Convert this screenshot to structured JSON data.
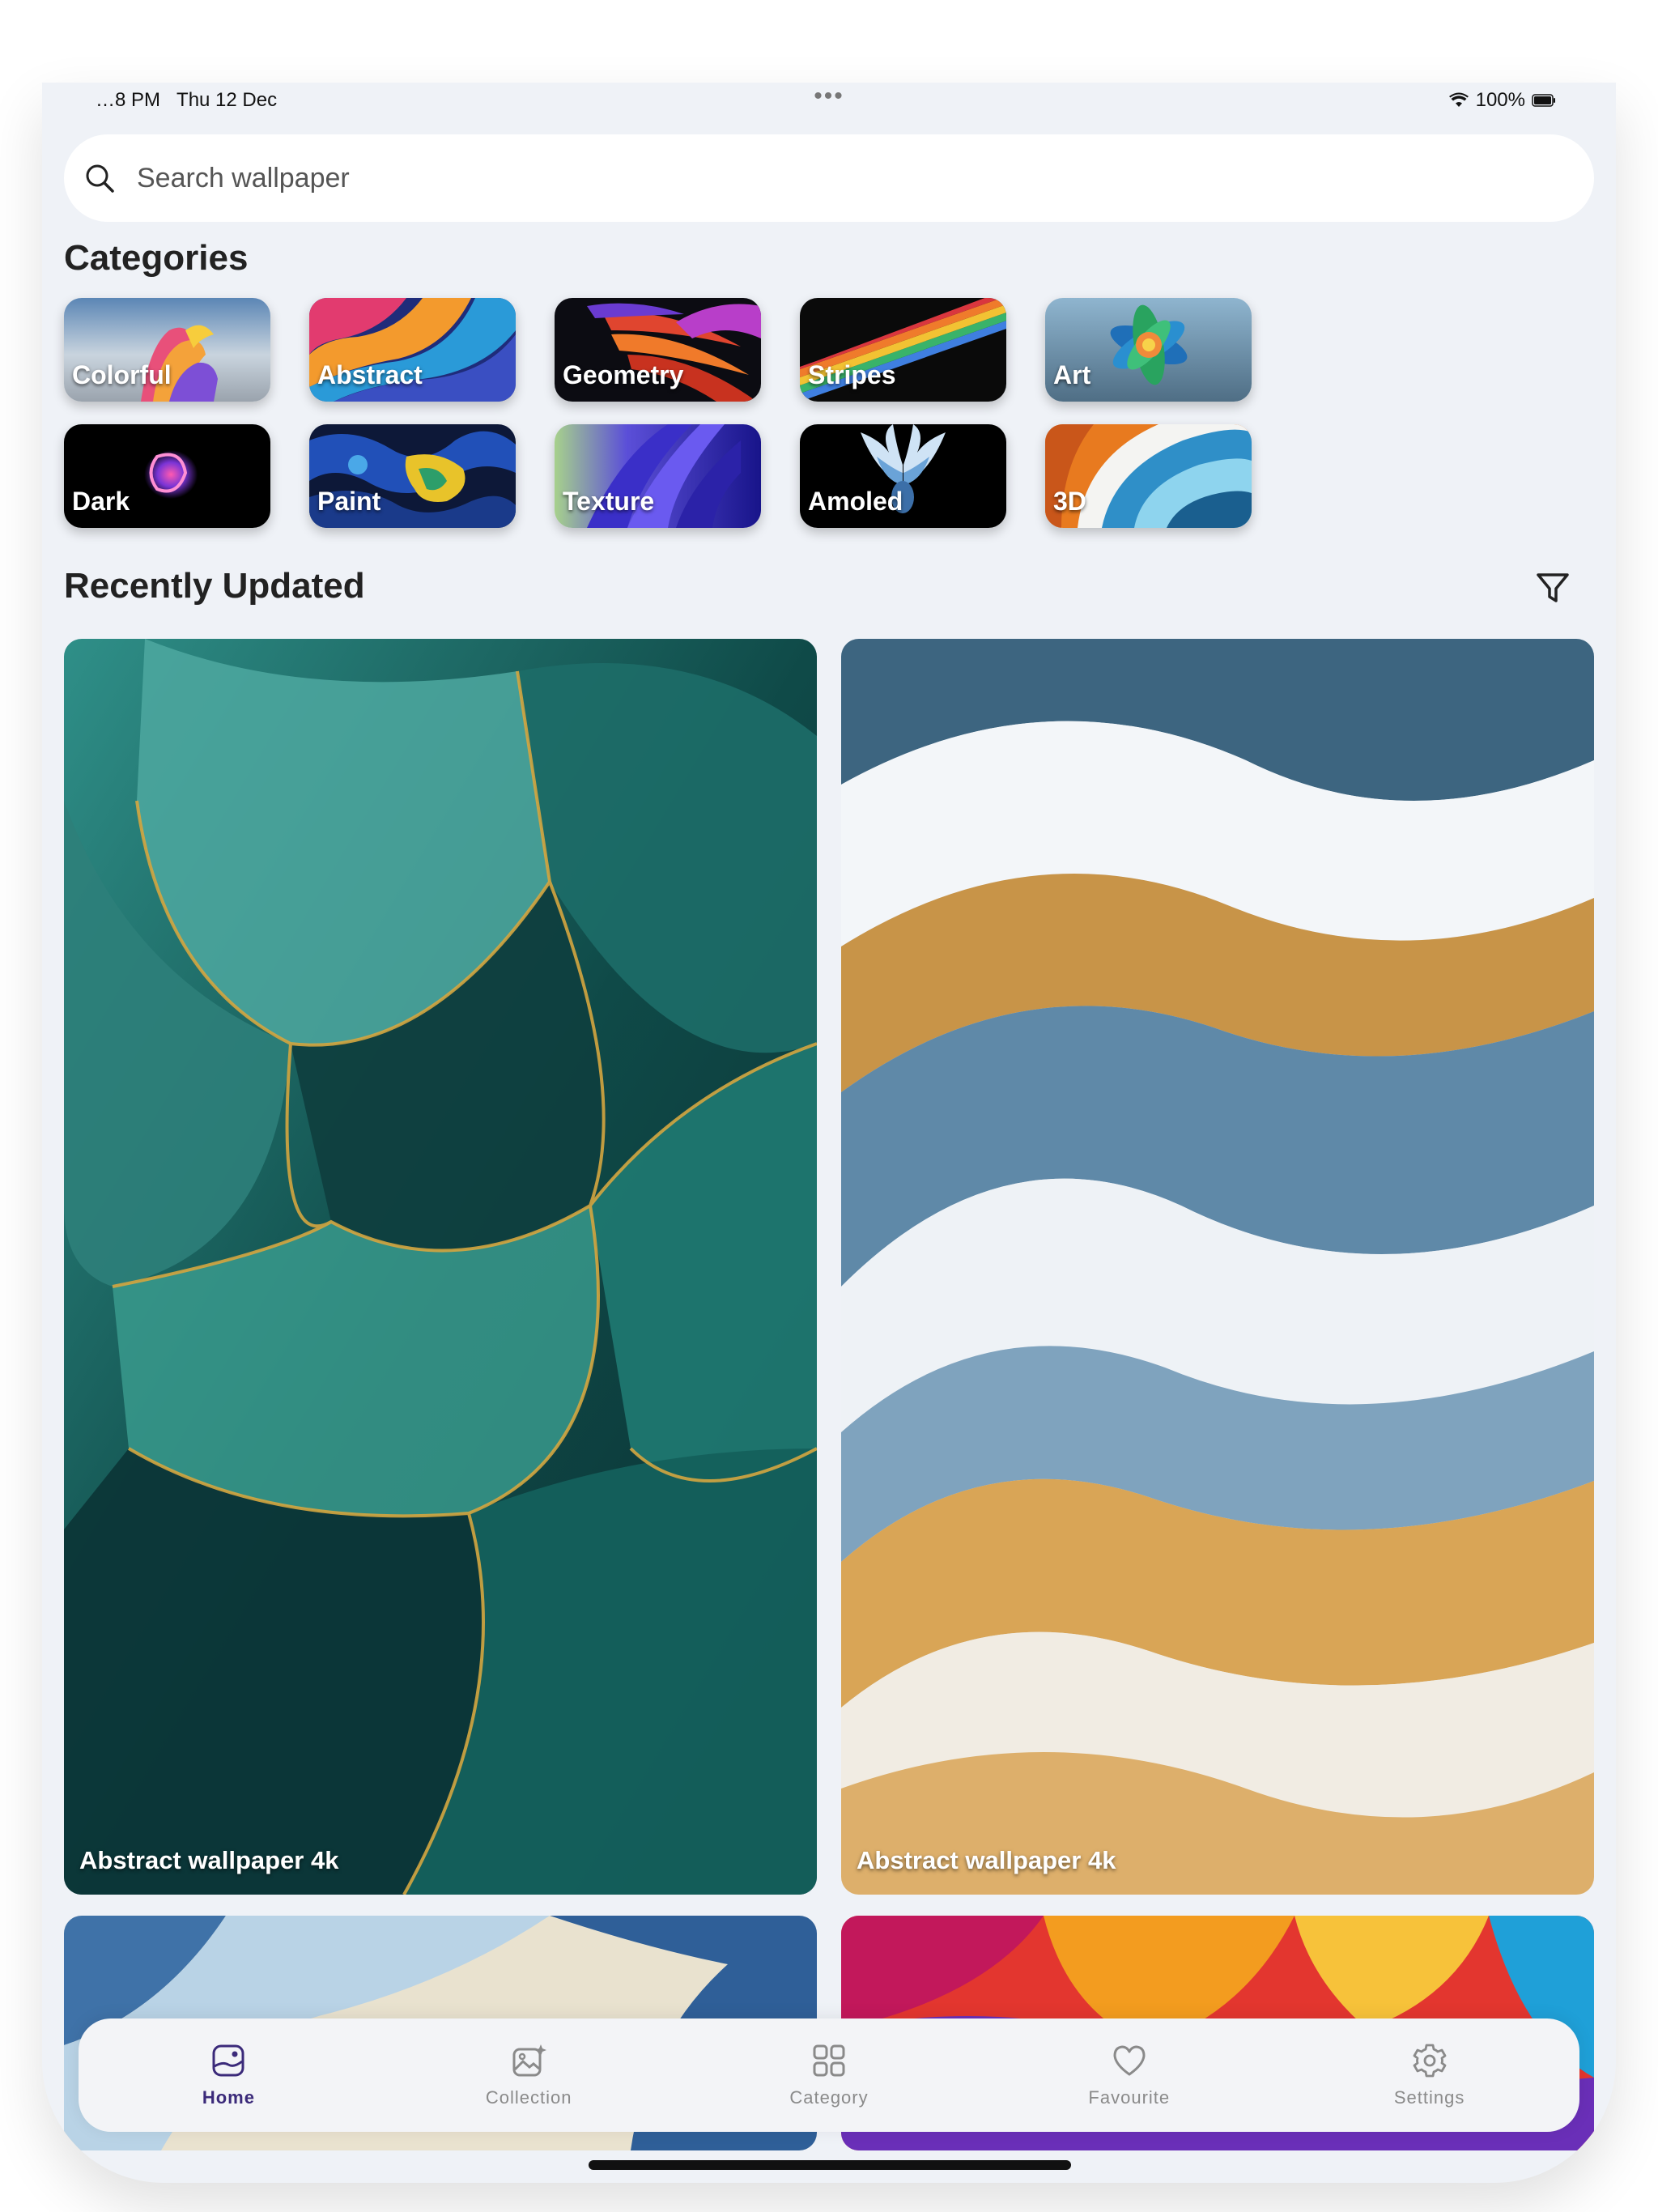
{
  "status_bar": {
    "time": "…8 PM",
    "date": "Thu 12 Dec",
    "more": "•••",
    "battery": "100%"
  },
  "search": {
    "placeholder": "Search wallpaper"
  },
  "sections": {
    "categories": "Categories",
    "recently_updated": "Recently Updated"
  },
  "categories": [
    {
      "label": "Colorful"
    },
    {
      "label": "Abstract"
    },
    {
      "label": "Geometry"
    },
    {
      "label": "Stripes"
    },
    {
      "label": "Art"
    },
    {
      "label": "Dark"
    },
    {
      "label": "Paint"
    },
    {
      "label": "Texture"
    },
    {
      "label": "Amoled"
    },
    {
      "label": "3D"
    }
  ],
  "wallpapers": [
    {
      "caption": "Abstract wallpaper 4k"
    },
    {
      "caption": "Abstract wallpaper 4k"
    }
  ],
  "tabs": [
    {
      "label": "Home",
      "icon": "home-icon",
      "active": true
    },
    {
      "label": "Collection",
      "icon": "collection-icon"
    },
    {
      "label": "Category",
      "icon": "category-icon"
    },
    {
      "label": "Favourite",
      "icon": "heart-icon"
    },
    {
      "label": "Settings",
      "icon": "gear-icon"
    }
  ],
  "colors": {
    "background": "#eff2f7",
    "active_tab": "#3b2a7a",
    "inactive_tab": "#8a8a8a"
  }
}
